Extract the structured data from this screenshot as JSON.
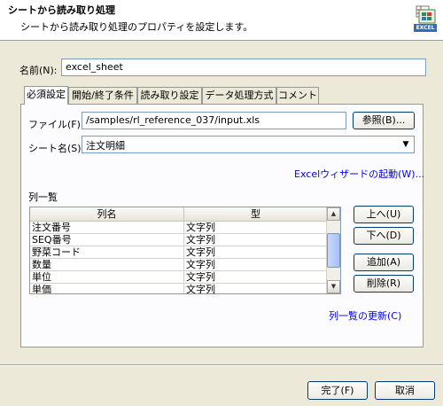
{
  "header": {
    "title": "シートから読み取り処理",
    "subtitle": "シートから読み取り処理のプロパティを設定します。",
    "icon": "excel-icon",
    "icon_text": "EXCEL"
  },
  "name_field": {
    "label": "名前(N):",
    "value": "excel_sheet"
  },
  "tabs": [
    {
      "label": "必須設定"
    },
    {
      "label": "開始/終了条件"
    },
    {
      "label": "読み取り設定"
    },
    {
      "label": "データ処理方式"
    },
    {
      "label": "コメント"
    }
  ],
  "file": {
    "label": "ファイル(F):",
    "value": "/samples/rl_reference_037/input.xls",
    "browse_label": "参照(B)..."
  },
  "sheet": {
    "label": "シート名(S):",
    "value": "注文明細"
  },
  "wizard_link": "Excelウィザードの起動(W)...",
  "columns_section": {
    "title": "列一覧",
    "headers": [
      "列名",
      "型"
    ],
    "rows": [
      [
        "注文番号",
        "文字列"
      ],
      [
        "SEQ番号",
        "文字列"
      ],
      [
        "野菜コード",
        "文字列"
      ],
      [
        "数量",
        "文字列"
      ],
      [
        "単位",
        "文字列"
      ],
      [
        "単価",
        "文字列"
      ]
    ]
  },
  "side_buttons": {
    "up": "上へ(U)",
    "down": "下へ(D)",
    "add": "追加(A)",
    "remove": "削除(R)"
  },
  "update_link": "列一覧の更新(C)",
  "footer": {
    "finish": "完了(F)",
    "cancel": "取消"
  }
}
